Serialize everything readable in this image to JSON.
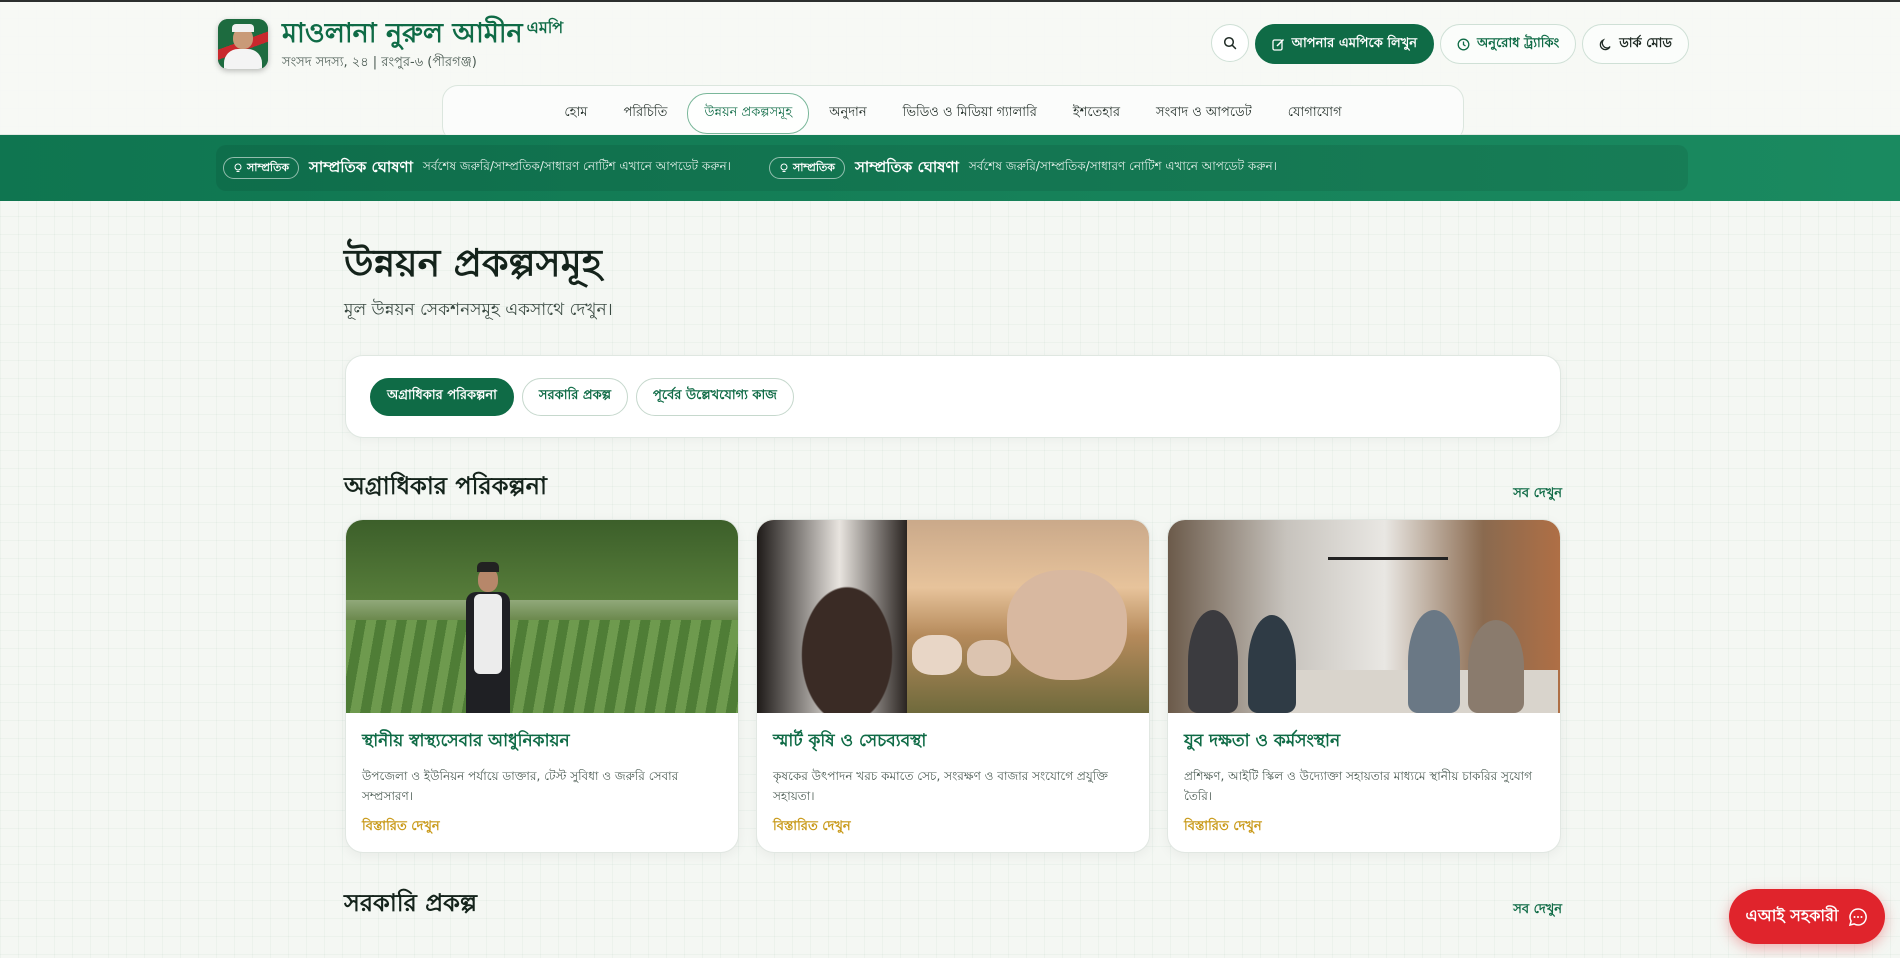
{
  "header": {
    "name": "মাওলানা নুরুল আমীন",
    "name_suffix": "এমপি",
    "subtitle": "সংসদ সদস্য, ২৪ | রংপুর-৬ (পীরগঞ্জ)",
    "write_button": "আপনার এমপিকে লিখুন",
    "tracking_button": "অনুরোধ ট্র্যাকিং",
    "dark_mode_button": "ডার্ক মোড"
  },
  "nav": {
    "items": [
      {
        "label": "হোম"
      },
      {
        "label": "পরিচিতি"
      },
      {
        "label": "উন্নয়ন প্রকল্পসমূহ"
      },
      {
        "label": "অনুদান"
      },
      {
        "label": "ভিডিও ও মিডিয়া গ্যালারি"
      },
      {
        "label": "ইশতেহার"
      },
      {
        "label": "সংবাদ ও আপডেট"
      },
      {
        "label": "যোগাযোগ"
      }
    ],
    "active_index": 2
  },
  "ticker": {
    "items": [
      {
        "badge": "সাম্প্রতিক",
        "title": "সাম্প্রতিক ঘোষণা",
        "text": "সর্বশেষ জরুরি/সাম্প্রতিক/সাধারণ নোটিশ এখানে আপডেট করুন।"
      },
      {
        "badge": "সাম্প্রতিক",
        "title": "সাম্প্রতিক ঘোষণা",
        "text": "সর্বশেষ জরুরি/সাম্প্রতিক/সাধারণ নোটিশ এখানে আপডেট করুন।"
      }
    ]
  },
  "page": {
    "title": "উন্নয়ন প্রকল্পসমূহ",
    "subtitle": "মূল উন্নয়ন সেকশনসমূহ একসাথে দেখুন।"
  },
  "tabs": [
    {
      "label": "অগ্রাধিকার পরিকল্পনা"
    },
    {
      "label": "সরকারি প্রকল্প"
    },
    {
      "label": "পূর্বের উল্লেখযোগ্য কাজ"
    }
  ],
  "section1": {
    "title": "অগ্রাধিকার পরিকল্পনা",
    "see_all": "সব দেখুন",
    "cards": [
      {
        "title": "স্থানীয় স্বাস্থ্যসেবার আধুনিকায়ন",
        "desc": "উপজেলা ও ইউনিয়ন পর্যায়ে ডাক্তার, টেস্ট সুবিধা ও জরুরি সেবার সম্প্রসারণ।",
        "link": "বিস্তারিত দেখুন"
      },
      {
        "title": "স্মার্ট কৃষি ও সেচব্যবস্থা",
        "desc": "কৃষকের উৎপাদন খরচ কমাতে সেচ, সংরক্ষণ ও বাজার সংযোগে প্রযুক্তি সহায়তা।",
        "link": "বিস্তারিত দেখুন"
      },
      {
        "title": "যুব দক্ষতা ও কর্মসংস্থান",
        "desc": "প্রশিক্ষণ, আইটি স্কিল ও উদ্যোক্তা সহায়তার মাধ্যমে স্থানীয় চাকরির সুযোগ তৈরি।",
        "link": "বিস্তারিত দেখুন"
      }
    ]
  },
  "section2": {
    "title": "সরকারি প্রকল্প",
    "see_all": "সব দেখুন"
  },
  "ai_button": "এআই সহকারী",
  "colors": {
    "brand": "#0f6b46",
    "ticker": "#168159",
    "accent_gold": "#c99a1a",
    "ai_red": "#e0242c"
  }
}
